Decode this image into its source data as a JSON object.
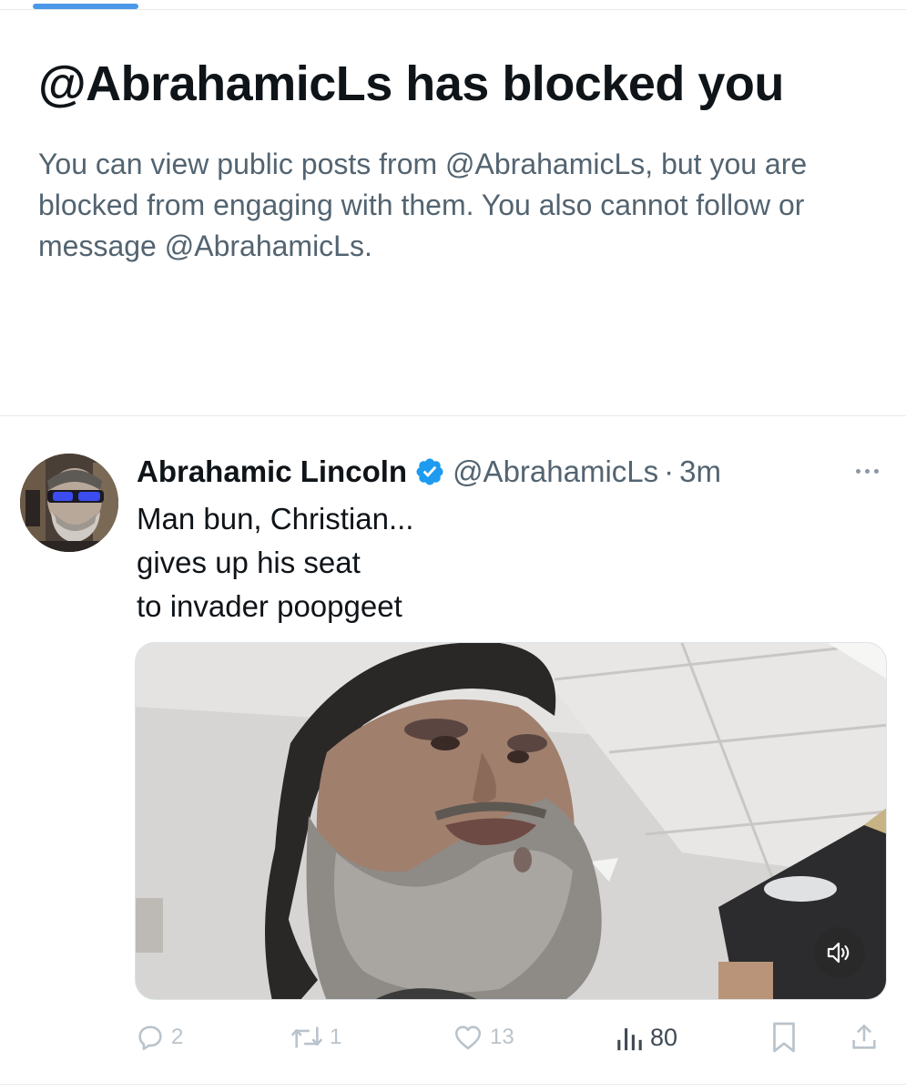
{
  "blocked_notice": {
    "title": "@AbrahamicLs has blocked you",
    "description": "You can view public posts from @AbrahamicLs, but you are blocked from engaging with them. You also cannot follow or message @AbrahamicLs."
  },
  "post": {
    "author_name": "Abrahamic Lincoln",
    "author_handle": "@AbrahamicLs",
    "separator": "·",
    "time": "3m",
    "verified": true,
    "text_lines": [
      "Man bun, Christian...",
      "gives up his seat",
      "to invader poopgeet"
    ],
    "media": {
      "type": "video",
      "muted": true
    }
  },
  "actions": {
    "replies": "2",
    "reposts": "1",
    "likes": "13",
    "views": "80"
  },
  "icons": {
    "verified": "verified-badge-icon",
    "more": "more-dots-icon",
    "mute": "speaker-icon",
    "reply": "reply-bubble-icon",
    "repost": "repost-icon",
    "like": "heart-icon",
    "views": "bar-chart-icon",
    "bookmark": "bookmark-icon",
    "share": "share-icon"
  },
  "colors": {
    "accent": "#1d9bf0",
    "text_primary": "#0f1419",
    "text_secondary": "#536471",
    "tab_indicator": "#4a99e9"
  }
}
